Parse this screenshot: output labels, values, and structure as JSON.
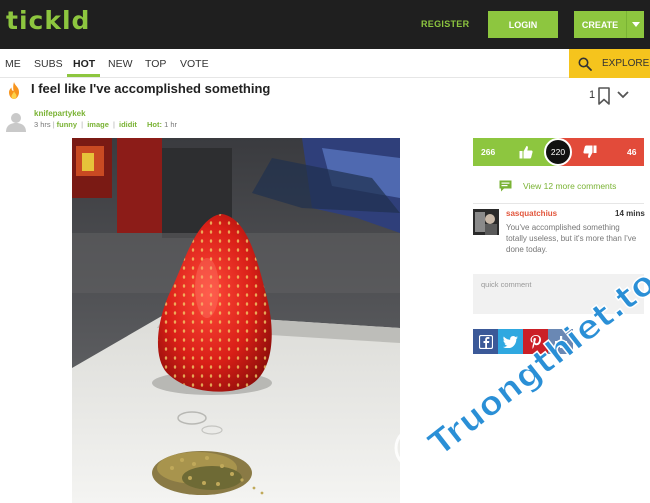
{
  "brand": {
    "logo": "tickld"
  },
  "header": {
    "register": "REGISTER",
    "login": "LOGIN",
    "create": "CREATE"
  },
  "nav": {
    "items": [
      {
        "label": "ME"
      },
      {
        "label": "SUBS"
      },
      {
        "label": "HOT",
        "active": true
      },
      {
        "label": "NEW"
      },
      {
        "label": "TOP"
      },
      {
        "label": "VOTE"
      }
    ],
    "explore": "EXPLORE"
  },
  "post": {
    "title": "I feel like I've accomplished something",
    "author": "knifepartykek",
    "age": "3 hrs",
    "tags": [
      "funny",
      "image",
      "ididit"
    ],
    "hot_label": "Hot:",
    "hot_value": "1 hr",
    "saves": "1"
  },
  "votes": {
    "up": "266",
    "score": "220",
    "down": "46"
  },
  "comments": {
    "view_more": "View 12 more comments",
    "items": [
      {
        "user": "sasquatchius",
        "time": "14 mins",
        "text": "You've accomplished something totally useless, but it's more than I've done today."
      }
    ],
    "quick_placeholder": "quick comment"
  },
  "share": {
    "icons": [
      "facebook-icon",
      "twitter-icon",
      "pinterest-icon",
      "plus-share-icon"
    ]
  },
  "watermark": {
    "text": "Truongthiet.top",
    "sub": "truongthiet.top"
  },
  "colors": {
    "brand_green": "#8dc63f",
    "explore_yellow": "#f5c41d",
    "downvote_red": "#e24b3a",
    "topbar_dark": "#1f1f1f",
    "facebook": "#3b5998",
    "twitter": "#2fa8e0",
    "pinterest": "#cb2027",
    "plus": "#6a88b4"
  }
}
